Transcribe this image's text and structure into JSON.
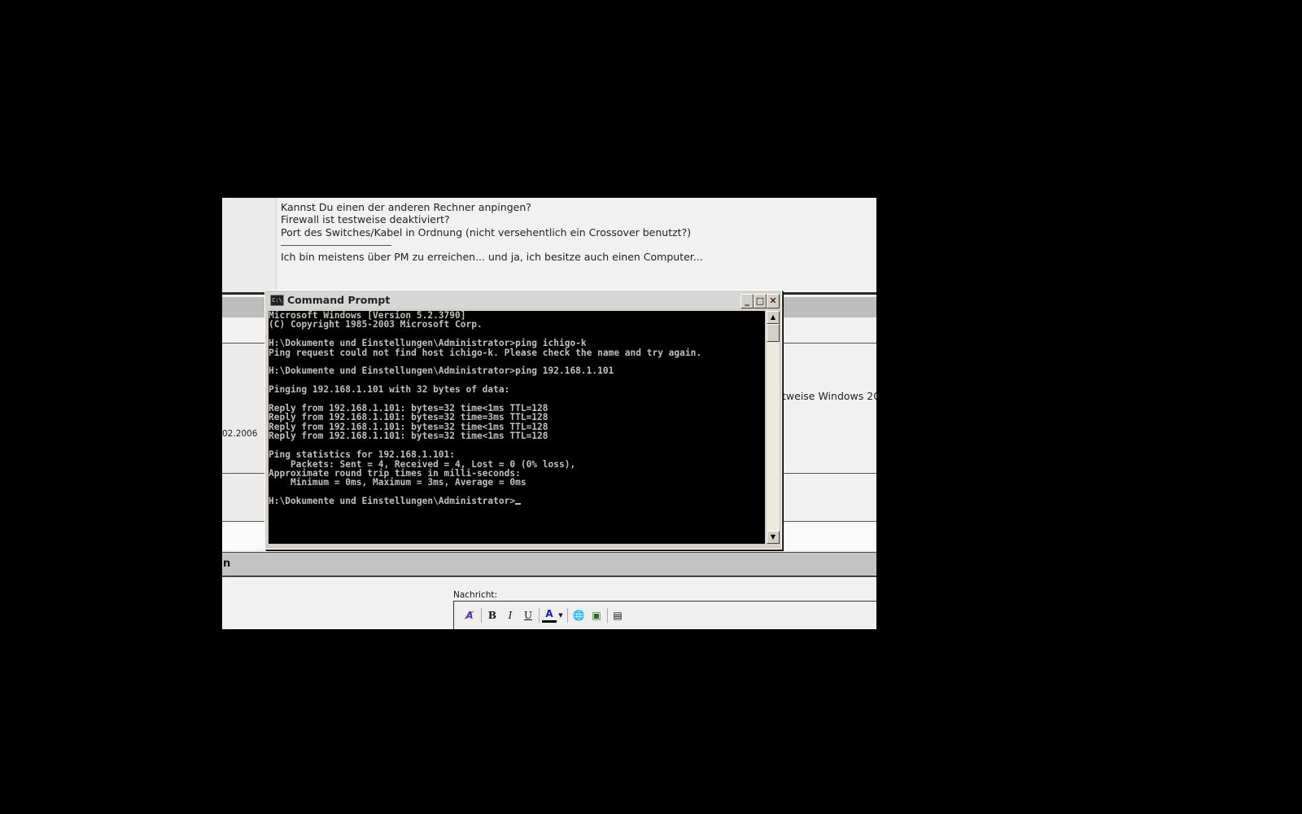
{
  "forum": {
    "post_lines": [
      "Kannst Du einen der anderen Rechner anpingen?",
      "Firewall ist testweise deaktiviert?",
      "Port des Switches/Kabel in Ordnung (nicht versehentlich ein Crossover benutzt?)"
    ],
    "signature": "Ich bin meistens über PM zu erreichen... und ja, ich besitze auch einen Computer...",
    "date_fragment": "02.2006",
    "text_fragment": "tweise Windows 20",
    "section_fragment": "n",
    "message_label": "Nachricht:",
    "toolbar": {
      "bold": "B",
      "italic": "I",
      "underline": "U",
      "font_color": "A"
    }
  },
  "cmd": {
    "title": "Command Prompt",
    "icon_text": "C:\\",
    "buttons": {
      "minimize": "_",
      "maximize": "□",
      "close": "✕"
    },
    "output": [
      "Microsoft Windows [Version 5.2.3790]",
      "(C) Copyright 1985-2003 Microsoft Corp.",
      "",
      "H:\\Dokumente und Einstellungen\\Administrator>ping ichigo-k",
      "Ping request could not find host ichigo-k. Please check the name and try again.",
      "",
      "H:\\Dokumente und Einstellungen\\Administrator>ping 192.168.1.101",
      "",
      "Pinging 192.168.1.101 with 32 bytes of data:",
      "",
      "Reply from 192.168.1.101: bytes=32 time<1ms TTL=128",
      "Reply from 192.168.1.101: bytes=32 time=3ms TTL=128",
      "Reply from 192.168.1.101: bytes=32 time<1ms TTL=128",
      "Reply from 192.168.1.101: bytes=32 time<1ms TTL=128",
      "",
      "Ping statistics for 192.168.1.101:",
      "    Packets: Sent = 4, Received = 4, Lost = 0 (0% loss),",
      "Approximate round trip times in milli-seconds:",
      "    Minimum = 0ms, Maximum = 3ms, Average = 0ms",
      ""
    ],
    "prompt": "H:\\Dokumente und Einstellungen\\Administrator>"
  }
}
